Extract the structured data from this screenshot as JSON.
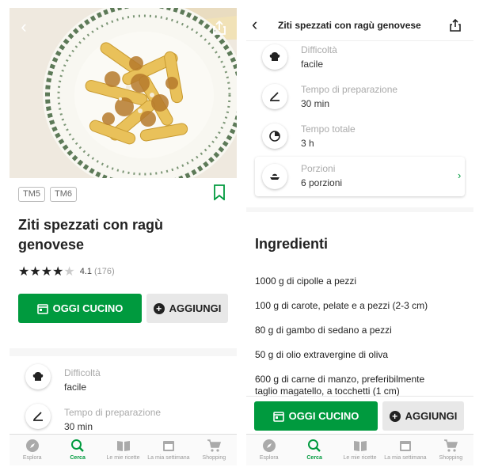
{
  "recipe": {
    "title": "Ziti spezzati con ragù genovese",
    "tags": [
      "TM5",
      "TM6"
    ],
    "rating_value": "4.1",
    "rating_count": "(176)",
    "rating_stars": 4.1
  },
  "actions": {
    "cook_today": "OGGI CUCINO",
    "add": "AGGIUNGI"
  },
  "info": {
    "difficulty_label": "Difficoltà",
    "difficulty_value": "facile",
    "prep_label": "Tempo di preparazione",
    "prep_value": "30 min",
    "total_label": "Tempo totale",
    "total_value": "3 h",
    "portions_label": "Porzioni",
    "portions_value": "6 porzioni"
  },
  "ingredients": {
    "title": "Ingredienti",
    "items": [
      "1000 g di cipolle a pezzi",
      "100 g di carote, pelate e a pezzi (2-3 cm)",
      "80 g di gambo di sedano a pezzi",
      "50 g di olio extravergine di oliva",
      "600 g di carne di manzo, preferibilmente",
      "taglio magatello, a tocchetti (1 cm)"
    ]
  },
  "nav": [
    {
      "label": "Esplora",
      "icon": "compass-icon"
    },
    {
      "label": "Cerca",
      "icon": "search-icon"
    },
    {
      "label": "Le mie ricette",
      "icon": "book-icon"
    },
    {
      "label": "La mia settimana",
      "icon": "calendar-icon"
    },
    {
      "label": "Shopping",
      "icon": "cart-icon"
    }
  ],
  "colors": {
    "accent": "#009a3e",
    "dark": "#222222"
  }
}
